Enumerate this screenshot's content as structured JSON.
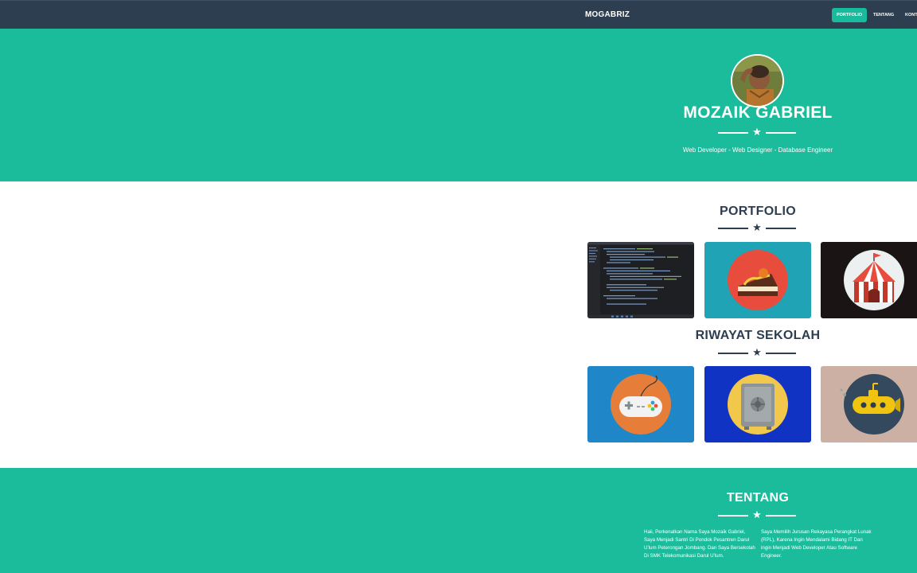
{
  "nav": {
    "brand": "MOGABRIZ",
    "items": [
      {
        "label": "PORTFOLIO",
        "active": true
      },
      {
        "label": "TENTANG",
        "active": false
      },
      {
        "label": "KONTAK",
        "active": false
      }
    ]
  },
  "hero": {
    "name": "MOZAIK GABRIEL",
    "subtitle": "Web Developer - Web Designer - Database Engineer"
  },
  "portfolio": {
    "title": "PORTFOLIO",
    "tiles": [
      {
        "icon": "code-editor-screenshot",
        "bg": "#1e1e1e"
      },
      {
        "icon": "cake-icon",
        "bg": "#1fa3b5"
      },
      {
        "icon": "circus-tent-icon",
        "bg": "#1a1414"
      }
    ]
  },
  "riwayat": {
    "title": "RIWAYAT SEKOLAH",
    "tiles": [
      {
        "icon": "game-controller-icon",
        "bg": "#1f87c8"
      },
      {
        "icon": "safe-icon",
        "bg": "#1133c4"
      },
      {
        "icon": "submarine-icon",
        "bg": "#cbb0a3"
      }
    ]
  },
  "about": {
    "title": "TENTANG",
    "col1": "Haii, Perkenalkan Nama Saya Mozaik Gabriel, Saya Menjadi Santri Di Pondok Pesantren Darul U'lum Peterongan Jombang. Dan Saya Bersekolah Di SMK Telekomunikasi Darul U'lum.",
    "col2": "Saya Memilih Jurusan Rekayasa Perangkat Lunak (RPL), Karena Ingin Mendalami Bidang IT Dan ingin Menjadi Web Developer Atau Software Engineer."
  },
  "colors": {
    "primary": "#1abc9c",
    "dark": "#2c3e50",
    "active_nav": "#18bc9c"
  }
}
